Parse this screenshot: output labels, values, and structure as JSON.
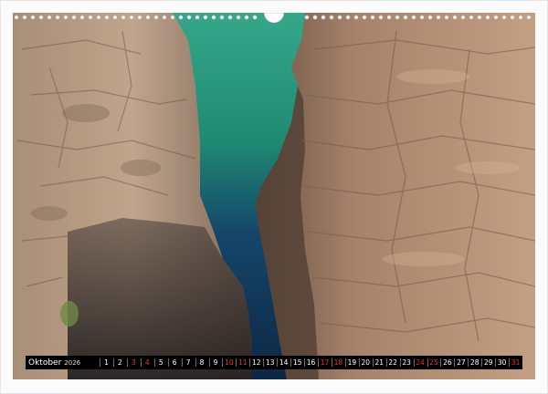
{
  "calendar": {
    "month": "Oktober",
    "year": "2026",
    "days": [
      {
        "d": "1",
        "we": false
      },
      {
        "d": "2",
        "we": false
      },
      {
        "d": "3",
        "we": true
      },
      {
        "d": "4",
        "we": true
      },
      {
        "d": "5",
        "we": false
      },
      {
        "d": "6",
        "we": false
      },
      {
        "d": "7",
        "we": false
      },
      {
        "d": "8",
        "we": false
      },
      {
        "d": "9",
        "we": false
      },
      {
        "d": "10",
        "we": true
      },
      {
        "d": "11",
        "we": true
      },
      {
        "d": "12",
        "we": false
      },
      {
        "d": "13",
        "we": false
      },
      {
        "d": "14",
        "we": false
      },
      {
        "d": "15",
        "we": false
      },
      {
        "d": "16",
        "we": false
      },
      {
        "d": "17",
        "we": true
      },
      {
        "d": "18",
        "we": true
      },
      {
        "d": "19",
        "we": false
      },
      {
        "d": "20",
        "we": false
      },
      {
        "d": "21",
        "we": false
      },
      {
        "d": "22",
        "we": false
      },
      {
        "d": "23",
        "we": false
      },
      {
        "d": "24",
        "we": true
      },
      {
        "d": "25",
        "we": true
      },
      {
        "d": "26",
        "we": false
      },
      {
        "d": "27",
        "we": false
      },
      {
        "d": "28",
        "we": false
      },
      {
        "d": "29",
        "we": false
      },
      {
        "d": "30",
        "we": false
      },
      {
        "d": "31",
        "we": true
      }
    ]
  },
  "colors": {
    "weekend": "#e03a2e",
    "weekday": "#ffffff",
    "bar": "#000000",
    "water": "#1f8f78",
    "rock": "#b08a6a"
  },
  "photo_subject": "canyon-gorge"
}
